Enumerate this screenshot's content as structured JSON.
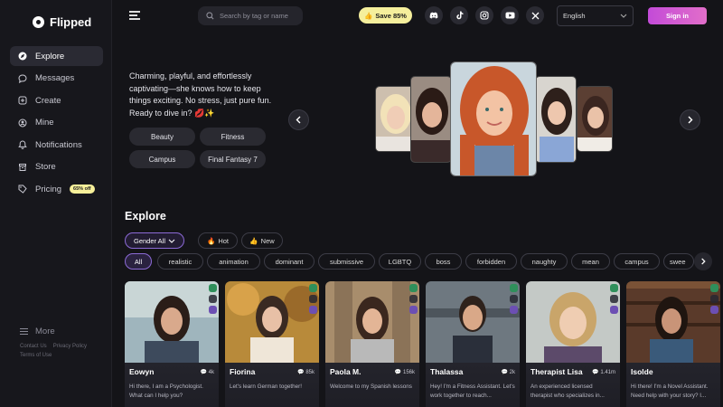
{
  "app": {
    "name": "Flipped"
  },
  "sidebar": {
    "items": [
      {
        "label": "Explore",
        "icon": "explore-icon",
        "active": true
      },
      {
        "label": "Messages",
        "icon": "message-icon"
      },
      {
        "label": "Create",
        "icon": "create-icon"
      },
      {
        "label": "Mine",
        "icon": "mine-icon"
      },
      {
        "label": "Notifications",
        "icon": "bell-icon"
      },
      {
        "label": "Store",
        "icon": "store-icon"
      },
      {
        "label": "Pricing",
        "icon": "tag-icon",
        "badge": "65% off"
      }
    ],
    "more_label": "More",
    "footer_links": [
      "Contact Us",
      "Privacy Policy",
      "Terms of Use"
    ]
  },
  "header": {
    "search_placeholder": "Search by tag or name",
    "save_label": "Save 85%",
    "social_icons": [
      "discord-icon",
      "tiktok-icon",
      "instagram-icon",
      "youtube-icon",
      "x-icon"
    ],
    "language": "English",
    "signin_label": "Sign in"
  },
  "hero": {
    "description": "Charming, playful, and effortlessly captivating—she knows how to keep things exciting. No stress, just pure fun. Ready to dive in? 💋✨",
    "tags": [
      "Beauty",
      "Fitness",
      "Campus",
      "Final Fantasy 7"
    ]
  },
  "explore": {
    "title": "Explore",
    "filters": {
      "gender": "Gender All",
      "hot": "Hot",
      "new": "New"
    },
    "chips": [
      "All",
      "realistic",
      "animation",
      "dominant",
      "submissive",
      "LGBTQ",
      "boss",
      "forbidden",
      "naughty",
      "mean",
      "campus",
      "swee"
    ],
    "cards": [
      {
        "name": "Eowyn",
        "count": "4k",
        "desc": "Hi there, I am a Psychologist. What can I help you?"
      },
      {
        "name": "Fiorina",
        "count": "85k",
        "desc": "Let's learn German together!"
      },
      {
        "name": "Paola M.",
        "count": "156k",
        "desc": "Welcome to my Spanish lessons"
      },
      {
        "name": "Thalassa",
        "count": "2k",
        "desc": "Hey! I'm a Fitness Assistant. Let's work together to reach..."
      },
      {
        "name": "Therapist Lisa",
        "count": "1.41m",
        "desc": "An experienced licensed therapist who specializes in..."
      },
      {
        "name": "Isolde",
        "count": "",
        "desc": "Hi there! I'm a Novel Assistant. Need help with your story? I..."
      }
    ]
  },
  "colors": {
    "accent": "#8c6ad6",
    "signin_start": "#c34bd8",
    "signin_end": "#e26ec9",
    "save_bg": "#f5ef9c"
  }
}
